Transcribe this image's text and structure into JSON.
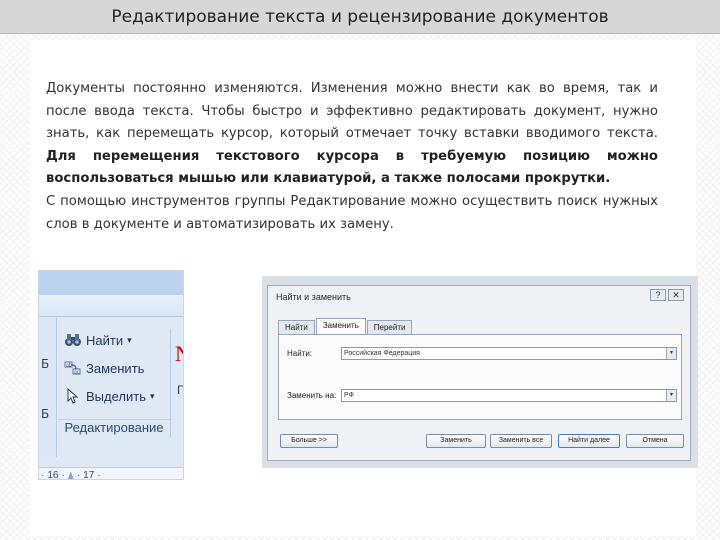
{
  "slide": {
    "title": "Редактирование текста и рецензирование документов",
    "paragraph1_normal": "Документы постоянно изменяются. Изменения можно внести как во время, так и после ввода текста. Чтобы быстро и эффективно редактировать документ, нужно знать, как перемещать курсор, который отмечает точку вставки вводимого текста. ",
    "paragraph1_bold": "Для перемещения текстового курсора в требуемую позицию можно воспользоваться мышью или клавиатурой, а также полосами прокрутки.",
    "paragraph2": "С помощью инструментов группы Редактирование можно осуществить поиск нужных слов в документе и автоматизировать их замену."
  },
  "ribbon": {
    "left_strip_letters": [
      "Б",
      "Б"
    ],
    "find_label": "Найти",
    "find_arrow": "▾",
    "replace_label": "Заменить",
    "select_label": "Выделить",
    "select_arrow": "▾",
    "group_label": "Редактирование",
    "partial_right_glyph": "N",
    "partial_right_text": "Г",
    "ruler_numbers": [
      "16",
      "17"
    ],
    "ruler_dots": "·",
    "icons": [
      "binoculars-icon",
      "replace-icon",
      "select-arrow-icon"
    ]
  },
  "dialog": {
    "title": "Найти и заменить",
    "controls": [
      "?",
      "✕"
    ],
    "tabs": [
      "Найти",
      "Заменить",
      "Перейти"
    ],
    "active_tab_index": 1,
    "find_label": "Найти:",
    "find_value": "Российская Федерация",
    "replace_label": "Заменить на:",
    "replace_value": "РФ",
    "buttons": {
      "more": "Больше >>",
      "replace": "Заменить",
      "replace_all": "Заменить все",
      "find_next": "Найти далее",
      "cancel": "Отмена"
    },
    "colors": {
      "border": "#9eabbd",
      "input_border": "#7f9db9",
      "default_button_border": "#3d7bd9"
    }
  }
}
